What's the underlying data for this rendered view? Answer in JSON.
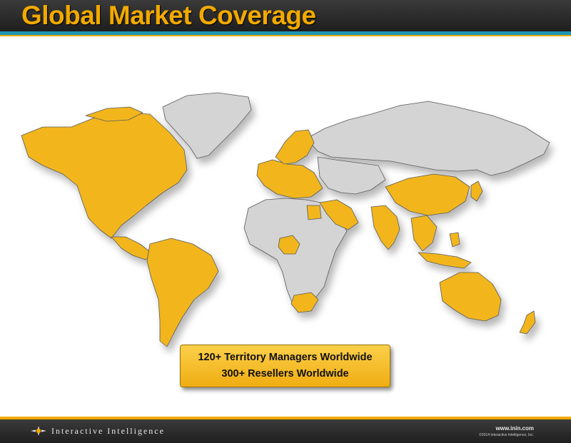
{
  "slide": {
    "title": "Global Market Coverage"
  },
  "callout": {
    "line1": "120+ Territory Managers Worldwide",
    "line2": "300+ Resellers Worldwide"
  },
  "footer": {
    "logo_text": "Interactive Intelligence",
    "url": "www.inin.com",
    "copyright": "©2014 Interactive Intelligence, Inc."
  },
  "map": {
    "highlight_color": "#f2b61e",
    "base_color": "#d4d4d4",
    "covered_regions": [
      "north-america",
      "central-america",
      "south-america",
      "western-europe",
      "scandinavia",
      "arabia",
      "nigeria",
      "south-africa",
      "india",
      "china",
      "japan",
      "southeast-asia",
      "australia",
      "new-zealand"
    ],
    "uncovered_regions": [
      "greenland",
      "russia",
      "africa",
      "central-asia",
      "middle-east"
    ]
  },
  "colors": {
    "header_bg": "#2a2a2a",
    "title_color": "#f2a900",
    "accent_blue": "#1f95b4",
    "accent_gold": "#f2a900"
  }
}
